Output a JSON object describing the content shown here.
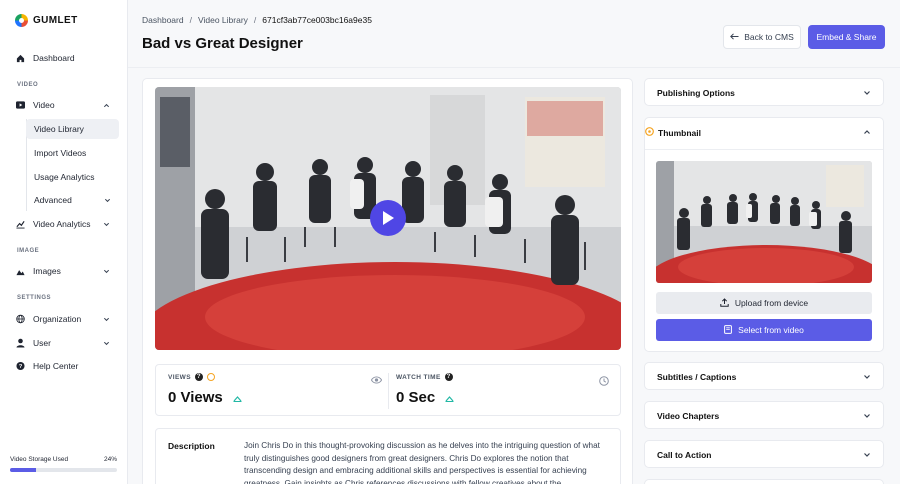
{
  "brand": {
    "name": "GUMLET"
  },
  "sidebar": {
    "dashboard": "Dashboard",
    "section_video": "VIDEO",
    "video": "Video",
    "video_library": "Video Library",
    "import_videos": "Import Videos",
    "usage_analytics": "Usage Analytics",
    "advanced": "Advanced",
    "video_analytics": "Video Analytics",
    "section_image": "IMAGE",
    "images": "Images",
    "section_settings": "SETTINGS",
    "organization": "Organization",
    "user": "User",
    "help_center": "Help Center",
    "storage_label": "Video Storage Used",
    "storage_percent": "24%",
    "storage_fraction": 0.24
  },
  "header": {
    "breadcrumb": [
      "Dashboard",
      "Video Library",
      "671cf3ab77ce003bc16a9e35"
    ],
    "title": "Bad vs Great Designer",
    "back_label": "Back to CMS",
    "embed_label": "Embed & Share"
  },
  "stats": {
    "views_label": "VIEWS",
    "views_value": "0 Views",
    "watch_label": "WATCH TIME",
    "watch_value": "0 Sec"
  },
  "description": {
    "label": "Description",
    "text": "Join Chris Do in this thought-provoking discussion as he delves into the intriguing question of what truly distinguishes good designers from great designers. Chris Do explores the notion that transcending design and embracing additional skills and perspectives is essential for achieving greatness. Gain insights as Chris references discussions with fellow creatives about the"
  },
  "panel": {
    "publishing": "Publishing Options",
    "thumbnail": "Thumbnail",
    "upload_label": "Upload from device",
    "select_label": "Select from video",
    "subtitles": "Subtitles / Captions",
    "chapters": "Video Chapters",
    "cta": "Call to Action"
  },
  "colors": {
    "accent": "#5b5ce6",
    "warning": "#f5a524"
  }
}
